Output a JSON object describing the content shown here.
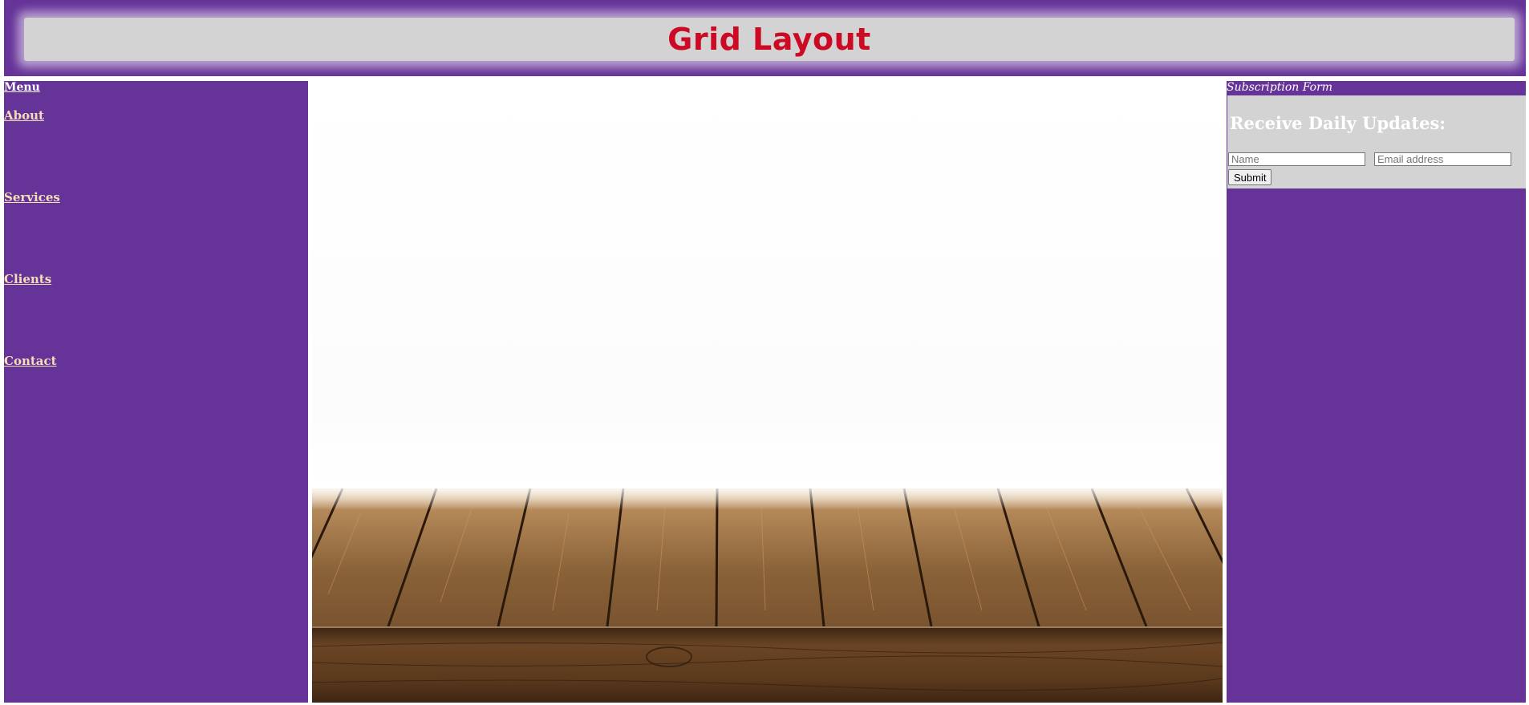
{
  "header": {
    "title": "Grid Layout"
  },
  "nav": {
    "menu_label": "Menu",
    "items": [
      {
        "label": "About"
      },
      {
        "label": "Services"
      },
      {
        "label": "Clients"
      },
      {
        "label": "Contact"
      }
    ]
  },
  "sidebar": {
    "caption": "Subscription Form",
    "heading": "Receive Daily Updates:",
    "name_placeholder": "Name",
    "email_placeholder": "Email address",
    "submit_label": "Submit"
  },
  "colors": {
    "purple": "#663399",
    "title_red": "#cc0a24",
    "panel_gray": "#d3d3d3",
    "link_wheat": "#f5deb3"
  }
}
